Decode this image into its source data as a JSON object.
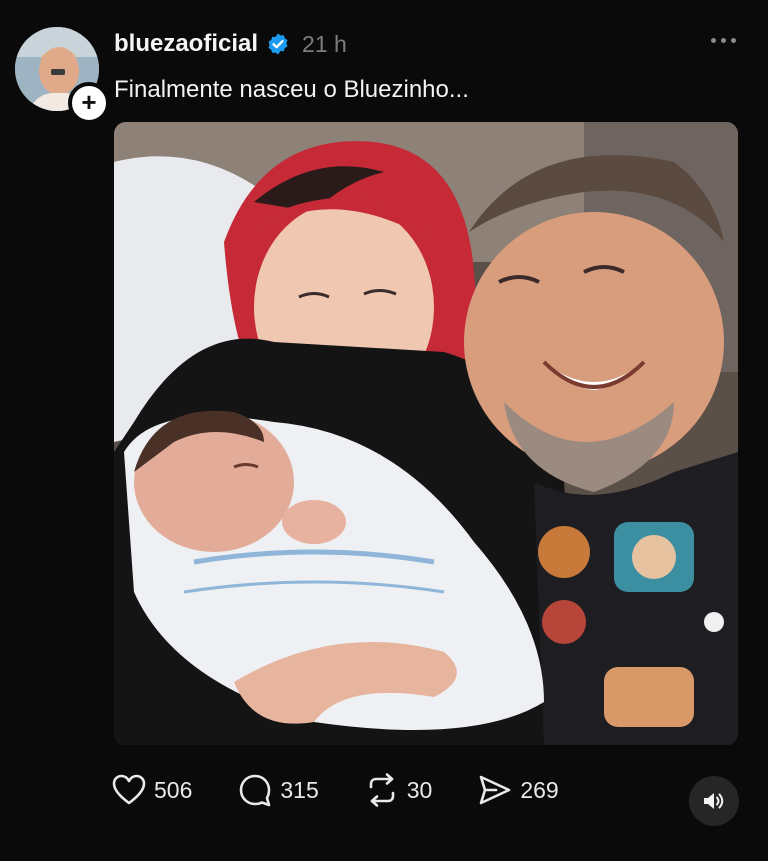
{
  "post": {
    "username": "bluezaoficial",
    "time_ago": "21 h",
    "caption": "Finalmente nasceu o Bluezinho...",
    "follow_symbol": "+",
    "media_description_icon": "photo"
  },
  "actions": {
    "likes": "506",
    "comments": "315",
    "reposts": "30",
    "shares": "269"
  },
  "colors": {
    "background": "#0a0a0a",
    "verified_badge": "#1d9bf0",
    "muted_text": "#7d7d7d"
  },
  "icons": [
    "verified-badge-icon",
    "more-options-icon",
    "heart-icon",
    "comment-icon",
    "repost-icon",
    "share-icon",
    "speaker-icon",
    "plus-icon"
  ]
}
